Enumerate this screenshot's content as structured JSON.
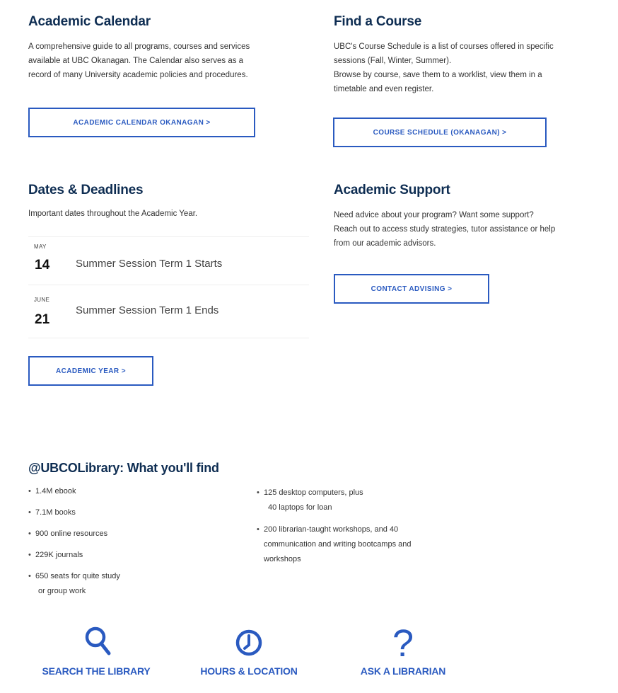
{
  "academic_calendar": {
    "title": "Academic Calendar",
    "desc_lines": [
      "A comprehensive guide to all programs, courses and services",
      "available at UBC Okanagan. The Calendar also serves as a",
      "record of many University academic policies and procedures."
    ],
    "button": "ACADEMIC CALENDAR OKANAGAN >"
  },
  "find_course": {
    "title": "Find a Course",
    "desc_lines": [
      "UBC's Course Schedule is a list of courses offered in specific",
      "sessions (Fall, Winter, Summer).",
      "Browse by course, save them to a worklist, view them in a",
      "timetable and even register."
    ],
    "button": "COURSE SCHEDULE (OKANAGAN) >"
  },
  "dates": {
    "title": "Dates & Deadlines",
    "desc": "Important dates throughout the Academic Year.",
    "items": [
      {
        "month": "MAY",
        "day": "14",
        "event": "Summer Session Term 1 Starts"
      },
      {
        "month": "JUNE",
        "day": "21",
        "event": "Summer Session Term 1 Ends"
      }
    ],
    "button": "ACADEMIC YEAR >"
  },
  "support": {
    "title": "Academic Support",
    "desc_lines": [
      "Need advice about your program? Want some support?",
      "Reach out to access study strategies, tutor assistance or help",
      "from our academic advisors."
    ],
    "button": "CONTACT ADVISING >"
  },
  "library": {
    "title": "@UBCOLibrary: What you'll find",
    "left_items": [
      "1.4M ebook",
      "7.1M books",
      "900 online resources",
      "229K journals",
      "650 seats for quite study",
      "or group work"
    ],
    "right_items": [
      "125 desktop computers, plus",
      "40 laptops for loan",
      "200 librarian-taught workshops, and 40",
      "communication and writing bootcamps and",
      "workshops"
    ]
  },
  "quick_links": [
    {
      "label": "SEARCH THE LIBRARY",
      "icon": "search-icon"
    },
    {
      "label": "HOURS & LOCATION",
      "icon": "clock-icon"
    },
    {
      "label": "ASK A LIBRARIAN",
      "icon": "question-icon"
    }
  ],
  "colors": {
    "heading": "#0e2d52",
    "accent": "#2a5ac0"
  }
}
